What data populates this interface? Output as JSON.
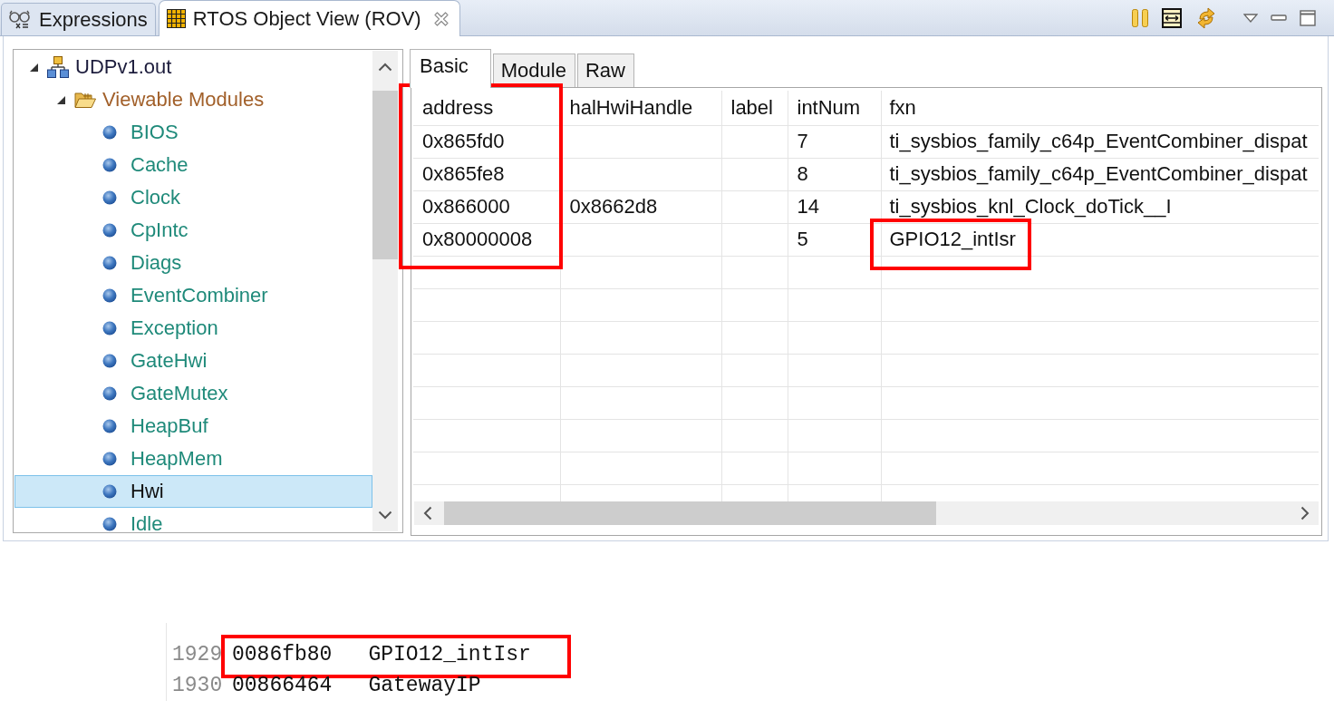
{
  "view_tabs": [
    {
      "label": "Expressions",
      "selected": false
    },
    {
      "label": "RTOS Object View (ROV)",
      "selected": true
    }
  ],
  "tree": [
    {
      "label": "UDPv1.out",
      "kind": "project",
      "expanded": true,
      "selected": false,
      "children": [
        {
          "label": "Viewable Modules",
          "kind": "folder",
          "expanded": true,
          "selected": false,
          "children": [
            {
              "label": "BIOS",
              "kind": "module",
              "selected": false
            },
            {
              "label": "Cache",
              "kind": "module",
              "selected": false
            },
            {
              "label": "Clock",
              "kind": "module",
              "selected": false
            },
            {
              "label": "CpIntc",
              "kind": "module",
              "selected": false
            },
            {
              "label": "Diags",
              "kind": "module",
              "selected": false
            },
            {
              "label": "EventCombiner",
              "kind": "module",
              "selected": false
            },
            {
              "label": "Exception",
              "kind": "module",
              "selected": false
            },
            {
              "label": "GateHwi",
              "kind": "module",
              "selected": false
            },
            {
              "label": "GateMutex",
              "kind": "module",
              "selected": false
            },
            {
              "label": "HeapBuf",
              "kind": "module",
              "selected": false
            },
            {
              "label": "HeapMem",
              "kind": "module",
              "selected": false
            },
            {
              "label": "Hwi",
              "kind": "module",
              "selected": true
            },
            {
              "label": "Idle",
              "kind": "module",
              "selected": false
            }
          ]
        }
      ]
    }
  ],
  "detail_tabs": [
    {
      "label": "Basic",
      "selected": true
    },
    {
      "label": "Module",
      "selected": false
    },
    {
      "label": "Raw",
      "selected": false
    }
  ],
  "table": {
    "columns": [
      {
        "label": "address",
        "highlighted": true
      },
      {
        "label": "halHwiHandle",
        "highlighted": false
      },
      {
        "label": "label",
        "highlighted": false
      },
      {
        "label": "intNum",
        "highlighted": false
      },
      {
        "label": "fxn",
        "highlighted": false
      }
    ],
    "rows": [
      {
        "cells": [
          {
            "text": "0x865fd0",
            "highlighted": false
          },
          {
            "highlighted": false
          },
          {
            "highlighted": false
          },
          {
            "text": "7",
            "highlighted": false
          },
          {
            "text": "ti_sysbios_family_c64p_EventCombiner_dispat",
            "highlighted": false
          }
        ]
      },
      {
        "cells": [
          {
            "text": "0x865fe8",
            "highlighted": false
          },
          {
            "highlighted": false
          },
          {
            "highlighted": false
          },
          {
            "text": "8",
            "highlighted": false
          },
          {
            "text": "ti_sysbios_family_c64p_EventCombiner_dispat",
            "highlighted": false
          }
        ]
      },
      {
        "cells": [
          {
            "text": "0x866000",
            "highlighted": false
          },
          {
            "text": "0x8662d8",
            "highlighted": false
          },
          {
            "highlighted": false
          },
          {
            "text": "14",
            "highlighted": false
          },
          {
            "text": "ti_sysbios_knl_Clock_doTick__I",
            "highlighted": false
          }
        ]
      },
      {
        "cells": [
          {
            "text": "0x80000008",
            "highlighted": false
          },
          {
            "highlighted": false
          },
          {
            "highlighted": false
          },
          {
            "text": "5",
            "highlighted": false
          },
          {
            "text": "GPIO12_intIsr",
            "highlighted": true
          }
        ]
      }
    ]
  },
  "code_listing": {
    "lines": [
      {
        "number": "1929",
        "address": "0086fb80",
        "symbol": "GPIO12_intIsr",
        "highlighted": true
      },
      {
        "number": "1930",
        "address": "00866464",
        "symbol": "GatewayIP",
        "highlighted": false
      }
    ]
  }
}
